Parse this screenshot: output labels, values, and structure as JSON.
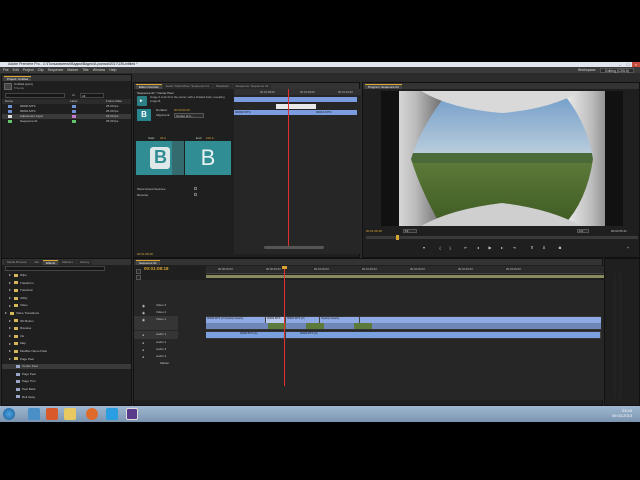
{
  "window": {
    "title": "Adobe Premiere Pro - C:\\Пользователи\\Вадим\\Видео\\А-ролики\\2017\\15\\Untitled *"
  },
  "menu": {
    "items": [
      "File",
      "Edit",
      "Project",
      "Clip",
      "Sequence",
      "Marker",
      "Title",
      "Window",
      "Help"
    ],
    "workspace_label": "Workspace:",
    "workspace_value": "Editing (CS5.5)"
  },
  "project": {
    "tab": "Project: Untitled",
    "filename": "Untitled.prproj",
    "item_count": "5 Items",
    "in_label": "In:",
    "in_value": "All",
    "col_name": "Name",
    "col_label": "Label",
    "col_framerate": "Frame Rate",
    "items": [
      {
        "name": "00000.MTS",
        "fps": "25.00 fps",
        "color": "#6f8fd6"
      },
      {
        "name": "00001.MTS",
        "fps": "25.00 fps",
        "color": "#6f8fd6"
      },
      {
        "name": "Adjustment Layer",
        "fps": "25.00 fps",
        "color": "#c77ad0"
      },
      {
        "name": "Sequence 01",
        "fps": "25.00 fps",
        "color": "#5fc46a"
      }
    ]
  },
  "effect_controls": {
    "tabs": [
      "Effect Controls",
      "Audio Track Mixer: Sequence 01",
      "Metadata",
      "Sequence: Sequence 01"
    ],
    "header": "Sequence 01 * Center Peel",
    "description": "Image A curls from the center, with a shaded back, revealing image B.",
    "duration_label": "Duration",
    "duration_value": "00:00:00:20",
    "alignment_label": "Alignment:",
    "alignment_value": "Center at C...",
    "start_label": "Start:",
    "start_value": "24.0",
    "end_label": "End:",
    "end_value": "100.0",
    "thumb_a": "A",
    "thumb_b": "B",
    "show_sources_label": "Show Actual Sources",
    "reverse_label": "Reverse",
    "timecode": "00:01:08:18",
    "ruler_times": [
      "00:01:08:00",
      "00:01:09:00",
      "00:01:10:00"
    ],
    "clip_a": "00000.MTS",
    "clip_b": "00001.MTS"
  },
  "program": {
    "tab": "Program: Sequence 01",
    "timecode": "00:01:08:18",
    "fit_value": "Fit",
    "quality_value": "1/2",
    "duration": "00:02:05:41"
  },
  "effects": {
    "tabs": [
      "Media Browser",
      "Info",
      "Effects",
      "Markers",
      "History"
    ],
    "tree": [
      {
        "label": "Wipe",
        "level": 1,
        "folder": true
      },
      {
        "label": "Transform",
        "level": 1,
        "folder": true
      },
      {
        "label": "Transition",
        "level": 1,
        "folder": true
      },
      {
        "label": "Utility",
        "level": 1,
        "folder": true
      },
      {
        "label": "Video",
        "level": 1,
        "folder": true
      },
      {
        "label": "Video Transitions",
        "level": 0,
        "folder": true
      },
      {
        "label": "3D Motion",
        "level": 1,
        "folder": true
      },
      {
        "label": "Dissolve",
        "level": 1,
        "folder": true
      },
      {
        "label": "Iris",
        "level": 1,
        "folder": true
      },
      {
        "label": "Map",
        "level": 1,
        "folder": true
      },
      {
        "label": "Modifier Name Pack",
        "level": 1,
        "folder": true
      },
      {
        "label": "Page Peel",
        "level": 1,
        "folder": true
      },
      {
        "label": "Center Peel",
        "level": 2,
        "folder": false
      },
      {
        "label": "Page Peel",
        "level": 2,
        "folder": false
      },
      {
        "label": "Page Turn",
        "level": 2,
        "folder": false
      },
      {
        "label": "Peel Back",
        "level": 2,
        "folder": false
      },
      {
        "label": "Roll Away",
        "level": 2,
        "folder": false
      }
    ]
  },
  "timeline": {
    "tab": "Sequence 01",
    "timecode": "00:01:08:18",
    "ruler": [
      "00:00:00:00",
      "00:00:30:00",
      "00:01:00:00",
      "00:01:30:00",
      "00:02:00:00",
      "00:02:30:00",
      "00:03:00:00"
    ],
    "video_tracks": [
      "Video 3",
      "Video 2",
      "Video 1"
    ],
    "audio_tracks": [
      "Audio 1",
      "Audio 2",
      "Audio 3",
      "Audio 4",
      "Master"
    ],
    "video_clips": [
      {
        "label": "00000.MTS [V]  Opacity:Opacity"
      },
      {
        "label": "00000.MTS"
      },
      {
        "label": "00001.MTS [V]"
      },
      {
        "label": "Opacity:Opacity"
      }
    ],
    "audio_clips": [
      {
        "label": "00000.MTS [A]"
      },
      {
        "label": "00000.MTS [A]"
      }
    ]
  },
  "taskbar": {
    "time": "23:44",
    "date": "09.03.2013"
  },
  "colors": {
    "accent": "#d8a533",
    "video_clip": "#8fa9e4",
    "audio_clip": "#7aa0e0",
    "playhead": "#e03030"
  }
}
